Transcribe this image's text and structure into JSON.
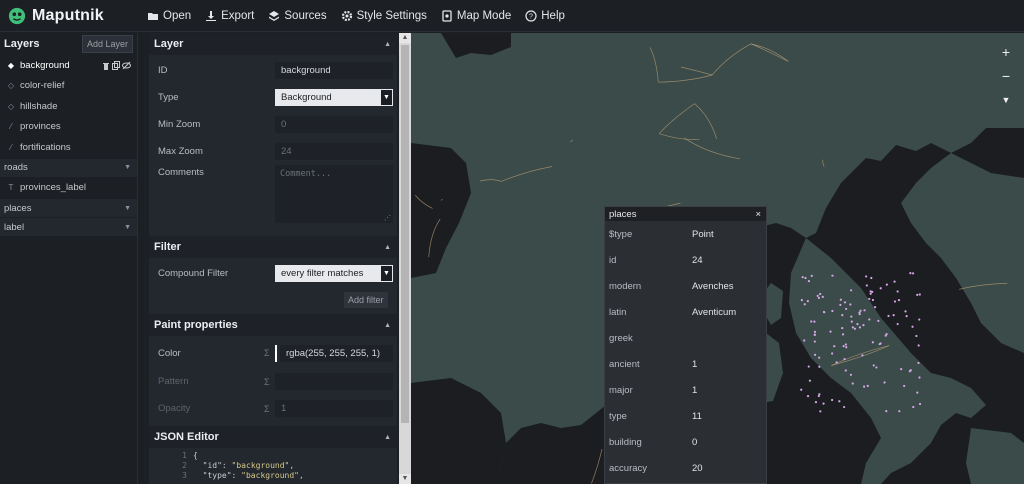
{
  "app": {
    "name": "Maputnik"
  },
  "toolbar": {
    "items": [
      {
        "label": "Open",
        "icon": "folder-open-icon"
      },
      {
        "label": "Export",
        "icon": "download-icon"
      },
      {
        "label": "Sources",
        "icon": "layers-icon"
      },
      {
        "label": "Style Settings",
        "icon": "gear-icon"
      },
      {
        "label": "Map Mode",
        "icon": "map-mode-icon"
      },
      {
        "label": "Help",
        "icon": "help-icon"
      }
    ]
  },
  "layers": {
    "title": "Layers",
    "add_label": "Add Layer",
    "items_top": [
      {
        "label": "background",
        "icon": "diamond-icon",
        "active": true
      },
      {
        "label": "color-relief",
        "icon": "diamond-outline-icon"
      },
      {
        "label": "hillshade",
        "icon": "diamond-outline-icon"
      },
      {
        "label": "provinces",
        "icon": "line-icon"
      },
      {
        "label": "fortifications",
        "icon": "line-icon"
      }
    ],
    "group_roads": "roads",
    "provinces_label": "provinces_label",
    "group_places": "places",
    "group_label": "label"
  },
  "editor": {
    "layer_section": "Layer",
    "id_label": "ID",
    "id_value": "background",
    "type_label": "Type",
    "type_value": "Background",
    "minzoom_label": "Min Zoom",
    "minzoom_value": "0",
    "maxzoom_label": "Max Zoom",
    "maxzoom_value": "24",
    "comments_label": "Comments",
    "comments_placeholder": "Comment...",
    "filter_section": "Filter",
    "compound_label": "Compound Filter",
    "compound_value": "every filter matches",
    "add_filter": "Add filter",
    "paint_section": "Paint properties",
    "color_label": "Color",
    "color_value": "rgba(255, 255, 255, 1)",
    "pattern_label": "Pattern",
    "opacity_label": "Opacity",
    "opacity_value": "1",
    "sigma": "Σ",
    "json_section": "JSON Editor",
    "json_lines": [
      {
        "n": "1",
        "text": "{"
      },
      {
        "n": "2",
        "key": "\"id\": ",
        "val": "\"background\","
      },
      {
        "n": "3",
        "key": "\"type\": ",
        "val": "\"background\","
      }
    ]
  },
  "map": {
    "zoom_in": "+",
    "zoom_out": "−",
    "compass": "▼",
    "colors": {
      "land": "#3a4b4a",
      "sea": "#1b1d20",
      "roads": "#b99d76",
      "places": "#d6a6e6",
      "borders": "#d0c3a8"
    }
  },
  "popup": {
    "title": "places",
    "close": "×",
    "rows": [
      {
        "k": "$type",
        "v": "Point"
      },
      {
        "k": "id",
        "v": "24"
      },
      {
        "k": "modern",
        "v": "Avenches"
      },
      {
        "k": "latin",
        "v": "Aventicum"
      },
      {
        "k": "greek",
        "v": ""
      },
      {
        "k": "ancient",
        "v": "1"
      },
      {
        "k": "major",
        "v": "1"
      },
      {
        "k": "type",
        "v": "11"
      },
      {
        "k": "building",
        "v": "0"
      },
      {
        "k": "accuracy",
        "v": "20"
      }
    ]
  }
}
